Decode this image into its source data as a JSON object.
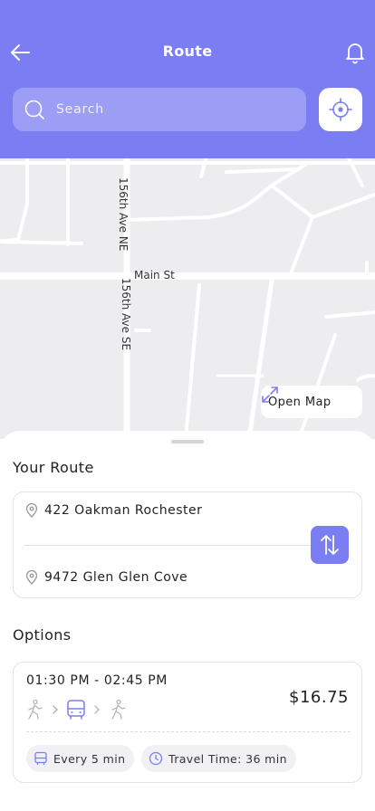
{
  "header": {
    "title": "Route",
    "search_placeholder": "Search",
    "accent_color": "#7B7DF2"
  },
  "map": {
    "street_labels": [
      "Main St",
      "156th Ave NE",
      "156th Ave SE"
    ],
    "open_map_label": "Open Map"
  },
  "your_route": {
    "title": "Your Route",
    "from": "422 Oakman Rochester",
    "to": "9472 Glen Glen Cove"
  },
  "options": {
    "title": "Options",
    "items": [
      {
        "time_range": "01:30 PM - 02:45 PM",
        "price": "$16.75",
        "modes": [
          "walk-icon",
          "bus-icon",
          "walk-icon"
        ],
        "frequency": "Every 5 min",
        "travel_time": "Travel Time: 36 min"
      }
    ]
  }
}
